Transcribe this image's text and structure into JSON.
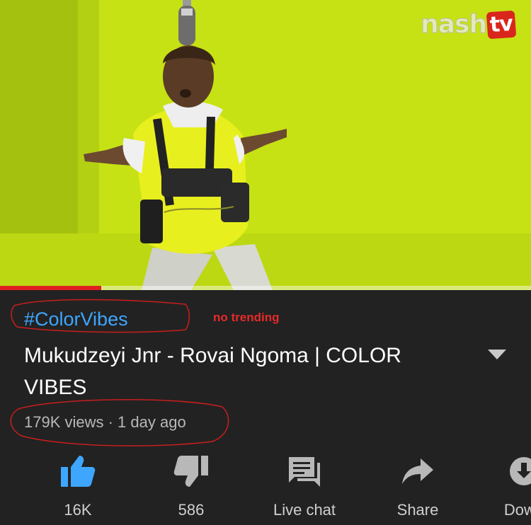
{
  "video": {
    "watermark_part1": "nash",
    "watermark_part2": "tv",
    "progress_fraction": 0.19,
    "background_color": "#c4e010"
  },
  "info": {
    "hashtag": "#ColorVibes",
    "annotation": "no trending",
    "title": "Mukudzeyi Jnr - Rovai Ngoma | COLOR VIBES",
    "meta": "179K views · 1 day ago"
  },
  "actions": [
    {
      "label": "16K",
      "icon": "thumbs-up-icon",
      "color": "#3ea6ff"
    },
    {
      "label": "586",
      "icon": "thumbs-down-icon",
      "color": "#b8b8b8"
    },
    {
      "label": "Live chat",
      "icon": "live-chat-icon",
      "color": "#b8b8b8"
    },
    {
      "label": "Share",
      "icon": "share-icon",
      "color": "#b8b8b8"
    },
    {
      "label": "Down",
      "icon": "download-icon",
      "color": "#b8b8b8"
    }
  ],
  "colors": {
    "background": "#222222",
    "accent_blue": "#3ea6ff",
    "annotation_red": "#e62a2a",
    "progress_red": "#e02020"
  }
}
